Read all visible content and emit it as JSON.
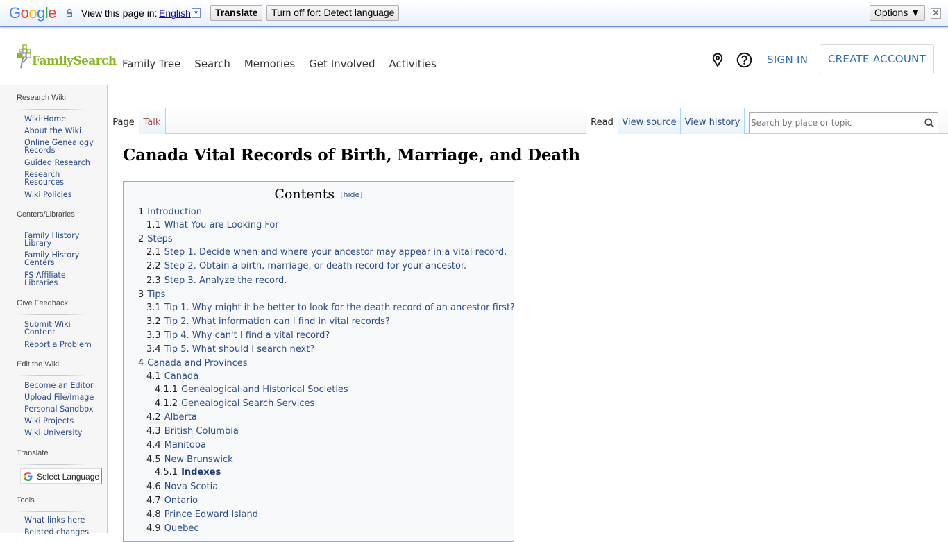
{
  "translate_bar": {
    "logo": "Google",
    "view_text": "View this page in:",
    "language": "English",
    "translate_button": "Translate",
    "turn_off_button": "Turn off for: Detect language",
    "options_button": "Options ▼",
    "close": "✕"
  },
  "header": {
    "logo_text": "FamilySearch",
    "nav": [
      "Family Tree",
      "Search",
      "Memories",
      "Get Involved",
      "Activities"
    ],
    "sign_in": "SIGN IN",
    "create_account": "CREATE ACCOUNT"
  },
  "sidebar": {
    "sections": [
      {
        "heading": "Research Wiki",
        "links": [
          "Wiki Home",
          "About the Wiki",
          "Online Genealogy Records",
          "Guided Research",
          "Research Resources",
          "Wiki Policies"
        ]
      },
      {
        "heading": "Centers/Libraries",
        "links": [
          "Family History Library",
          "Family History Centers",
          "FS Affiliate Libraries"
        ]
      },
      {
        "heading": "Give Feedback",
        "links": [
          "Submit Wiki Content",
          "Report a Problem"
        ]
      },
      {
        "heading": "Edit the Wiki",
        "links": [
          "Become an Editor",
          "Upload File/Image",
          "Personal Sandbox",
          "Wiki Projects",
          "Wiki University"
        ]
      },
      {
        "heading": "Translate",
        "links": []
      },
      {
        "heading": "Tools",
        "links": [
          "What links here",
          "Related changes"
        ]
      }
    ],
    "select_language": "Select Language"
  },
  "tabs": {
    "page": "Page",
    "talk": "Talk",
    "read": "Read",
    "view_source": "View source",
    "view_history": "View history",
    "search_placeholder": "Search by place or topic"
  },
  "article": {
    "title": "Canada Vital Records of Birth, Marriage, and Death",
    "toc_title": "Contents",
    "toc_hide": "hide",
    "toc": [
      {
        "num": "1",
        "label": "Introduction",
        "level": 1
      },
      {
        "num": "1.1",
        "label": "What You are Looking For",
        "level": 2
      },
      {
        "num": "2",
        "label": "Steps",
        "level": 1
      },
      {
        "num": "2.1",
        "label": "Step 1. Decide when and where your ancestor may appear in a vital record.",
        "level": 2
      },
      {
        "num": "2.2",
        "label": "Step 2. Obtain a birth, marriage, or death record for your ancestor.",
        "level": 2
      },
      {
        "num": "2.3",
        "label": "Step 3. Analyze the record.",
        "level": 2
      },
      {
        "num": "3",
        "label": "Tips",
        "level": 1
      },
      {
        "num": "3.1",
        "label": "Tip 1. Why might it be better to look for the death record of an ancestor first?",
        "level": 2
      },
      {
        "num": "3.2",
        "label": "Tip 2. What information can I find in vital records?",
        "level": 2
      },
      {
        "num": "3.3",
        "label": "Tip 4. Why can't I find a vital record?",
        "level": 2
      },
      {
        "num": "3.4",
        "label": "Tip 5. What should I search next?",
        "level": 2
      },
      {
        "num": "4",
        "label": "Canada and Provinces",
        "level": 1
      },
      {
        "num": "4.1",
        "label": "Canada",
        "level": 2
      },
      {
        "num": "4.1.1",
        "label": "Genealogical and Historical Societies",
        "level": 3
      },
      {
        "num": "4.1.2",
        "label": "Genealogical Search Services",
        "level": 3
      },
      {
        "num": "4.2",
        "label": "Alberta",
        "level": 2
      },
      {
        "num": "4.3",
        "label": "British Columbia",
        "level": 2
      },
      {
        "num": "4.4",
        "label": "Manitoba",
        "level": 2
      },
      {
        "num": "4.5",
        "label": "New Brunswick",
        "level": 2
      },
      {
        "num": "4.5.1",
        "label": "Indexes",
        "level": 3,
        "bold": true
      },
      {
        "num": "4.6",
        "label": "Nova Scotia",
        "level": 2
      },
      {
        "num": "4.7",
        "label": "Ontario",
        "level": 2
      },
      {
        "num": "4.8",
        "label": "Prince Edward Island",
        "level": 2
      },
      {
        "num": "4.9",
        "label": "Quebec",
        "level": 2
      }
    ]
  }
}
